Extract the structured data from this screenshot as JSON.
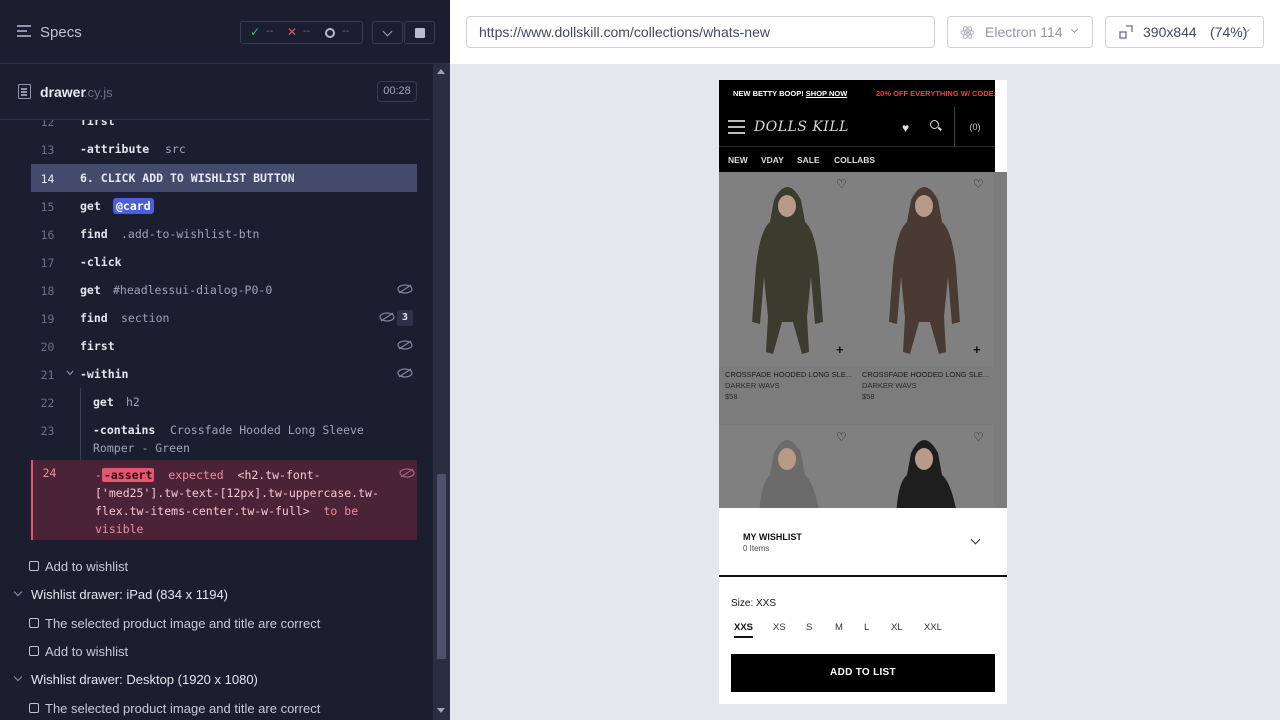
{
  "reporter": {
    "specs_title": "Specs",
    "stats": {
      "passed": "--",
      "failed": "--",
      "pending": "--"
    },
    "file": {
      "name": "drawer",
      "ext": ".cy.js",
      "duration": "00:28"
    },
    "commands": [
      {
        "num": "12",
        "name": "first",
        "arg": ""
      },
      {
        "num": "13",
        "name": "-attribute",
        "arg": "src"
      },
      {
        "num": "14",
        "name": "6. CLICK ADD TO WISHLIST BUTTON",
        "arg": ""
      },
      {
        "num": "15",
        "name": "get",
        "arg": "@card"
      },
      {
        "num": "16",
        "name": "find",
        "arg": ".add-to-wishlist-btn"
      },
      {
        "num": "17",
        "name": "-click",
        "arg": ""
      },
      {
        "num": "18",
        "name": "get",
        "arg": "#headlessui-dialog-P0-0"
      },
      {
        "num": "19",
        "name": "find",
        "arg": "section",
        "count": "3"
      },
      {
        "num": "20",
        "name": "first",
        "arg": ""
      },
      {
        "num": "21",
        "name": "-within",
        "arg": ""
      },
      {
        "num": "22",
        "name": "get",
        "arg": "h2"
      },
      {
        "num": "23",
        "name": "-contains",
        "arg": "Crossfade Hooded Long Sleeve",
        "arg2": "Romper - Green"
      }
    ],
    "error": {
      "num": "24",
      "name": "-assert",
      "expected": "expected",
      "target_l1": "<h2.tw-font-",
      "target_l2": "['med25'].tw-text-[12px].tw-uppercase.tw-",
      "target_l3": "flex.tw-items-center.tw-w-full>",
      "tail_l3": "to be",
      "tail_l4": "visible"
    },
    "tests": [
      {
        "label": "Add to wishlist",
        "type": "test"
      },
      {
        "label": "Wishlist drawer: iPad (834 x 1194)",
        "type": "suite"
      },
      {
        "label": "The selected product image and title are correct",
        "type": "test"
      },
      {
        "label": "Add to wishlist",
        "type": "test"
      },
      {
        "label": "Wishlist drawer: Desktop (1920 x 1080)",
        "type": "suite"
      },
      {
        "label": "The selected product image and title are correct",
        "type": "test"
      }
    ]
  },
  "aut": {
    "url": "https://www.dollskill.com/collections/whats-new",
    "browser": "Electron 114",
    "viewport": "390x844",
    "scale": "(74%)"
  },
  "site": {
    "promo_left": "NEW BETTY BOOP!",
    "promo_link": "SHOP NOW",
    "promo_right": "20% OFF EVERYTHING W/ CODE:",
    "logo": "DOLLS KILL",
    "bag": "(0)",
    "nav": [
      "NEW",
      "VDAY",
      "SALE",
      "COLLABS"
    ],
    "products": [
      {
        "name": "CROSSFADE HOODED LONG SLE...",
        "brand": "DARKER WAVS",
        "price": "$58"
      },
      {
        "name": "CROSSFADE HOODED LONG SLE...",
        "brand": "DARKER WAVS",
        "price": "$58"
      }
    ],
    "wishlist": {
      "title": "MY WISHLIST",
      "count": "0 Items",
      "size_label": "Size: XXS",
      "sizes": [
        "XXS",
        "XS",
        "S",
        "M",
        "L",
        "XL",
        "XXL"
      ],
      "button": "ADD TO LIST"
    }
  }
}
